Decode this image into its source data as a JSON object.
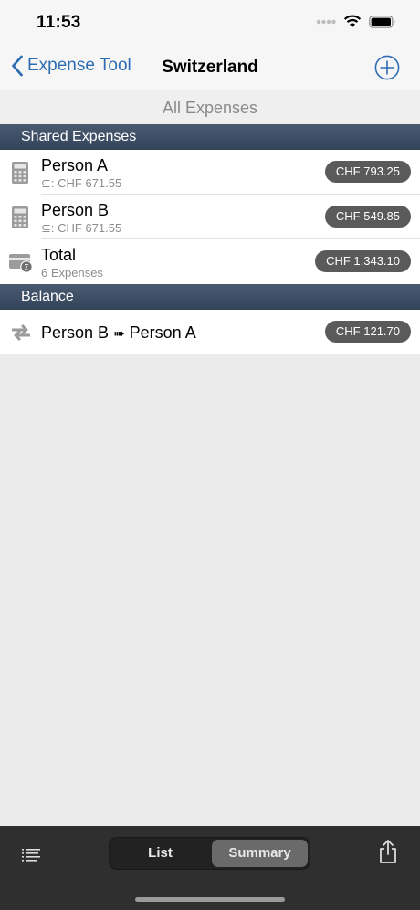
{
  "status": {
    "time": "11:53"
  },
  "nav": {
    "back_label": "Expense Tool",
    "title": "Switzerland"
  },
  "filter": {
    "label": "All Expenses"
  },
  "shared": {
    "header": "Shared Expenses",
    "rows": [
      {
        "title": "Person A",
        "subtitle": "⊆: CHF 671.55",
        "amount": "CHF 793.25",
        "icon": "calculator-icon"
      },
      {
        "title": "Person B",
        "subtitle": "⊆: CHF 671.55",
        "amount": "CHF 549.85",
        "icon": "calculator-icon"
      }
    ],
    "total": {
      "title": "Total",
      "subtitle": "6 Expenses",
      "amount": "CHF 1,343.10",
      "icon": "wallet-sum-icon"
    }
  },
  "balance": {
    "header": "Balance",
    "from": "Person B",
    "arrow": "➠",
    "to": "Person A",
    "amount": "CHF 121.70",
    "icon": "transfer-arrows-icon"
  },
  "tabbar": {
    "list_label": "List",
    "summary_label": "Summary",
    "selected": "Summary"
  },
  "colors": {
    "accent": "#2e6db4",
    "section_header": "#3d4d63",
    "pill": "#5a5a5a",
    "tabbar": "#2f2f2f"
  }
}
